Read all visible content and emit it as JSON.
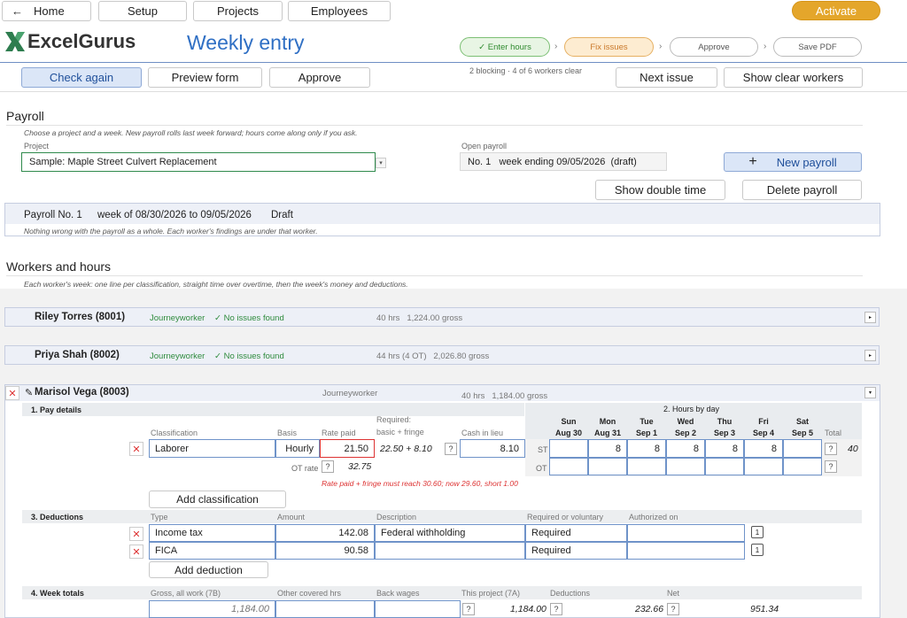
{
  "toolbar": {
    "home_label": "Home",
    "setup_label": "Setup",
    "projects_label": "Projects",
    "employees_label": "Employees",
    "activate_label": "Activate"
  },
  "brand": {
    "name": "ExcelGurus",
    "page_title": "Weekly entry"
  },
  "steps": [
    {
      "label": "✓ Enter hours"
    },
    {
      "label": "Fix issues"
    },
    {
      "label": "Approve"
    },
    {
      "label": "Save PDF"
    }
  ],
  "actions": {
    "check_again": "Check again",
    "preview_form": "Preview form",
    "approve": "Approve",
    "status": "2 blocking · 4 of 6 workers clear",
    "next_issue": "Next issue",
    "show_clear_workers": "Show clear workers"
  },
  "payroll": {
    "heading": "Payroll",
    "hint": "Choose a project and a week. New payroll rolls last week forward; hours come along only if you ask.",
    "project_label": "Project",
    "project_value": "Sample: Maple Street Culvert Replacement",
    "open_payroll_label": "Open payroll",
    "open_payroll_value": "No. 1   week ending 09/05/2026  (draft)",
    "new_payroll": "New payroll",
    "show_double_time": "Show double time",
    "delete_payroll": "Delete payroll",
    "summary_no": "Payroll No. 1",
    "summary_week": "week of 08/30/2026 to 09/05/2026",
    "summary_status": "Draft",
    "summary_note": "Nothing wrong with the payroll as a whole. Each worker's findings are under that worker."
  },
  "workers_section": {
    "heading": "Workers and hours",
    "hint": "Each worker's week: one line per classification, straight time over overtime, then the week's money and deductions."
  },
  "workers": [
    {
      "name": "Riley Torres (8001)",
      "class": "Journeyworker",
      "status": "✓ No issues found",
      "hours": "40 hrs   1,224.00 gross"
    },
    {
      "name": "Priya Shah (8002)",
      "class": "Journeyworker",
      "status": "✓ No issues found",
      "hours": "44 hrs (4 OT)   2,026.80 gross"
    }
  ],
  "open_worker": {
    "name": "Marisol Vega (8003)",
    "class": "Journeyworker",
    "hours": "40 hrs   1,184.00 gross",
    "pay_details": {
      "title": "1. Pay details",
      "col_classification": "Classification",
      "col_basis": "Basis",
      "col_rate_paid": "Rate paid",
      "col_required": "Required:",
      "col_required_sub": "basic + fringe",
      "col_cash": "Cash in lieu",
      "classification": "Laborer",
      "basis": "Hourly",
      "rate_paid": "21.50",
      "required_value": "22.50 + 8.10",
      "cash": "8.10",
      "ot_rate_label": "OT rate",
      "ot_rate_value": "32.75",
      "error": "Rate paid + fringe must reach 30.60; now 29.60, short 1.00",
      "add_classification": "Add classification"
    },
    "hours_by_day": {
      "title": "2. Hours by day",
      "days": [
        {
          "day": "Sun",
          "date": "Aug 30",
          "st": ""
        },
        {
          "day": "Mon",
          "date": "Aug 31",
          "st": "8"
        },
        {
          "day": "Tue",
          "date": "Sep 1",
          "st": "8"
        },
        {
          "day": "Wed",
          "date": "Sep 2",
          "st": "8"
        },
        {
          "day": "Thu",
          "date": "Sep 3",
          "st": "8"
        },
        {
          "day": "Fri",
          "date": "Sep 4",
          "st": "8"
        },
        {
          "day": "Sat",
          "date": "Sep 5",
          "st": ""
        }
      ],
      "total_label": "Total",
      "st_label": "ST",
      "ot_label": "OT",
      "st_total": "40"
    },
    "deductions": {
      "title": "3. Deductions",
      "col_type": "Type",
      "col_amount": "Amount",
      "col_description": "Description",
      "col_required": "Required or voluntary",
      "col_authorized": "Authorized on",
      "rows": [
        {
          "type": "Income tax",
          "amount": "142.08",
          "description": "Federal withholding",
          "required": "Required"
        },
        {
          "type": "FICA",
          "amount": "90.58",
          "description": "",
          "required": "Required"
        }
      ],
      "add_deduction": "Add deduction"
    },
    "week_totals": {
      "title": "4. Week totals",
      "col_gross": "Gross, all work (7B)",
      "col_other": "Other covered hrs",
      "col_back": "Back wages",
      "col_this_project": "This project (7A)",
      "col_deductions": "Deductions",
      "col_net": "Net",
      "gross": "1,184.00",
      "this_project": "1,184.00",
      "deductions": "232.66",
      "net": "951.34"
    }
  }
}
